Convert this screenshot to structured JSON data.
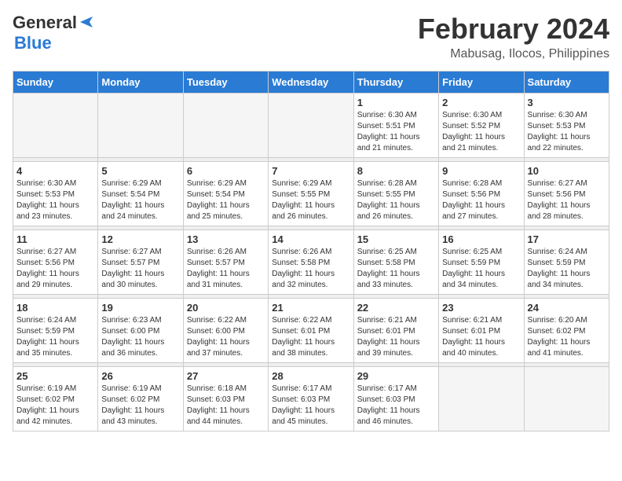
{
  "logo": {
    "line1": "General",
    "line2": "Blue"
  },
  "title": "February 2024",
  "location": "Mabusag, Ilocos, Philippines",
  "weekdays": [
    "Sunday",
    "Monday",
    "Tuesday",
    "Wednesday",
    "Thursday",
    "Friday",
    "Saturday"
  ],
  "weeks": [
    [
      {
        "day": "",
        "info": ""
      },
      {
        "day": "",
        "info": ""
      },
      {
        "day": "",
        "info": ""
      },
      {
        "day": "",
        "info": ""
      },
      {
        "day": "1",
        "info": "Sunrise: 6:30 AM\nSunset: 5:51 PM\nDaylight: 11 hours\nand 21 minutes."
      },
      {
        "day": "2",
        "info": "Sunrise: 6:30 AM\nSunset: 5:52 PM\nDaylight: 11 hours\nand 21 minutes."
      },
      {
        "day": "3",
        "info": "Sunrise: 6:30 AM\nSunset: 5:53 PM\nDaylight: 11 hours\nand 22 minutes."
      }
    ],
    [
      {
        "day": "4",
        "info": "Sunrise: 6:30 AM\nSunset: 5:53 PM\nDaylight: 11 hours\nand 23 minutes."
      },
      {
        "day": "5",
        "info": "Sunrise: 6:29 AM\nSunset: 5:54 PM\nDaylight: 11 hours\nand 24 minutes."
      },
      {
        "day": "6",
        "info": "Sunrise: 6:29 AM\nSunset: 5:54 PM\nDaylight: 11 hours\nand 25 minutes."
      },
      {
        "day": "7",
        "info": "Sunrise: 6:29 AM\nSunset: 5:55 PM\nDaylight: 11 hours\nand 26 minutes."
      },
      {
        "day": "8",
        "info": "Sunrise: 6:28 AM\nSunset: 5:55 PM\nDaylight: 11 hours\nand 26 minutes."
      },
      {
        "day": "9",
        "info": "Sunrise: 6:28 AM\nSunset: 5:56 PM\nDaylight: 11 hours\nand 27 minutes."
      },
      {
        "day": "10",
        "info": "Sunrise: 6:27 AM\nSunset: 5:56 PM\nDaylight: 11 hours\nand 28 minutes."
      }
    ],
    [
      {
        "day": "11",
        "info": "Sunrise: 6:27 AM\nSunset: 5:56 PM\nDaylight: 11 hours\nand 29 minutes."
      },
      {
        "day": "12",
        "info": "Sunrise: 6:27 AM\nSunset: 5:57 PM\nDaylight: 11 hours\nand 30 minutes."
      },
      {
        "day": "13",
        "info": "Sunrise: 6:26 AM\nSunset: 5:57 PM\nDaylight: 11 hours\nand 31 minutes."
      },
      {
        "day": "14",
        "info": "Sunrise: 6:26 AM\nSunset: 5:58 PM\nDaylight: 11 hours\nand 32 minutes."
      },
      {
        "day": "15",
        "info": "Sunrise: 6:25 AM\nSunset: 5:58 PM\nDaylight: 11 hours\nand 33 minutes."
      },
      {
        "day": "16",
        "info": "Sunrise: 6:25 AM\nSunset: 5:59 PM\nDaylight: 11 hours\nand 34 minutes."
      },
      {
        "day": "17",
        "info": "Sunrise: 6:24 AM\nSunset: 5:59 PM\nDaylight: 11 hours\nand 34 minutes."
      }
    ],
    [
      {
        "day": "18",
        "info": "Sunrise: 6:24 AM\nSunset: 5:59 PM\nDaylight: 11 hours\nand 35 minutes."
      },
      {
        "day": "19",
        "info": "Sunrise: 6:23 AM\nSunset: 6:00 PM\nDaylight: 11 hours\nand 36 minutes."
      },
      {
        "day": "20",
        "info": "Sunrise: 6:22 AM\nSunset: 6:00 PM\nDaylight: 11 hours\nand 37 minutes."
      },
      {
        "day": "21",
        "info": "Sunrise: 6:22 AM\nSunset: 6:01 PM\nDaylight: 11 hours\nand 38 minutes."
      },
      {
        "day": "22",
        "info": "Sunrise: 6:21 AM\nSunset: 6:01 PM\nDaylight: 11 hours\nand 39 minutes."
      },
      {
        "day": "23",
        "info": "Sunrise: 6:21 AM\nSunset: 6:01 PM\nDaylight: 11 hours\nand 40 minutes."
      },
      {
        "day": "24",
        "info": "Sunrise: 6:20 AM\nSunset: 6:02 PM\nDaylight: 11 hours\nand 41 minutes."
      }
    ],
    [
      {
        "day": "25",
        "info": "Sunrise: 6:19 AM\nSunset: 6:02 PM\nDaylight: 11 hours\nand 42 minutes."
      },
      {
        "day": "26",
        "info": "Sunrise: 6:19 AM\nSunset: 6:02 PM\nDaylight: 11 hours\nand 43 minutes."
      },
      {
        "day": "27",
        "info": "Sunrise: 6:18 AM\nSunset: 6:03 PM\nDaylight: 11 hours\nand 44 minutes."
      },
      {
        "day": "28",
        "info": "Sunrise: 6:17 AM\nSunset: 6:03 PM\nDaylight: 11 hours\nand 45 minutes."
      },
      {
        "day": "29",
        "info": "Sunrise: 6:17 AM\nSunset: 6:03 PM\nDaylight: 11 hours\nand 46 minutes."
      },
      {
        "day": "",
        "info": ""
      },
      {
        "day": "",
        "info": ""
      }
    ]
  ]
}
